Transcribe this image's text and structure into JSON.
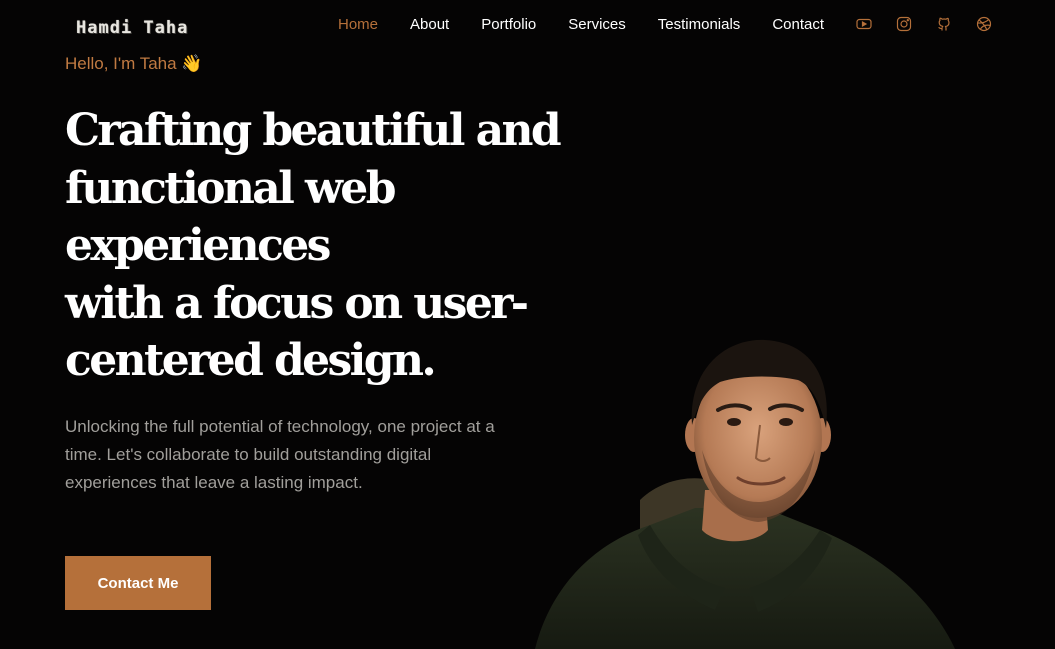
{
  "brand": {
    "logo_text": "Hamdi Taha"
  },
  "nav": {
    "items": [
      {
        "label": "Home",
        "active": true
      },
      {
        "label": "About",
        "active": false
      },
      {
        "label": "Portfolio",
        "active": false
      },
      {
        "label": "Services",
        "active": false
      },
      {
        "label": "Testimonials",
        "active": false
      },
      {
        "label": "Contact",
        "active": false
      }
    ]
  },
  "social": [
    {
      "icon": "youtube-icon"
    },
    {
      "icon": "instagram-icon"
    },
    {
      "icon": "github-icon"
    },
    {
      "icon": "dribbble-icon"
    }
  ],
  "hero": {
    "greeting": "Hello, I'm Taha 👋",
    "headline_lines": [
      "Crafting beautiful and",
      "functional web",
      "experiences",
      "with a focus on user-",
      "centered design."
    ],
    "tagline": "Unlocking the full potential of technology, one project at a time. Let's collaborate to build outstanding digital experiences that leave a lasting impact.",
    "cta_label": "Contact Me"
  },
  "colors": {
    "background": "#050404",
    "accent": "#b5703a",
    "text": "#ffffff",
    "muted": "#a19f9b"
  }
}
